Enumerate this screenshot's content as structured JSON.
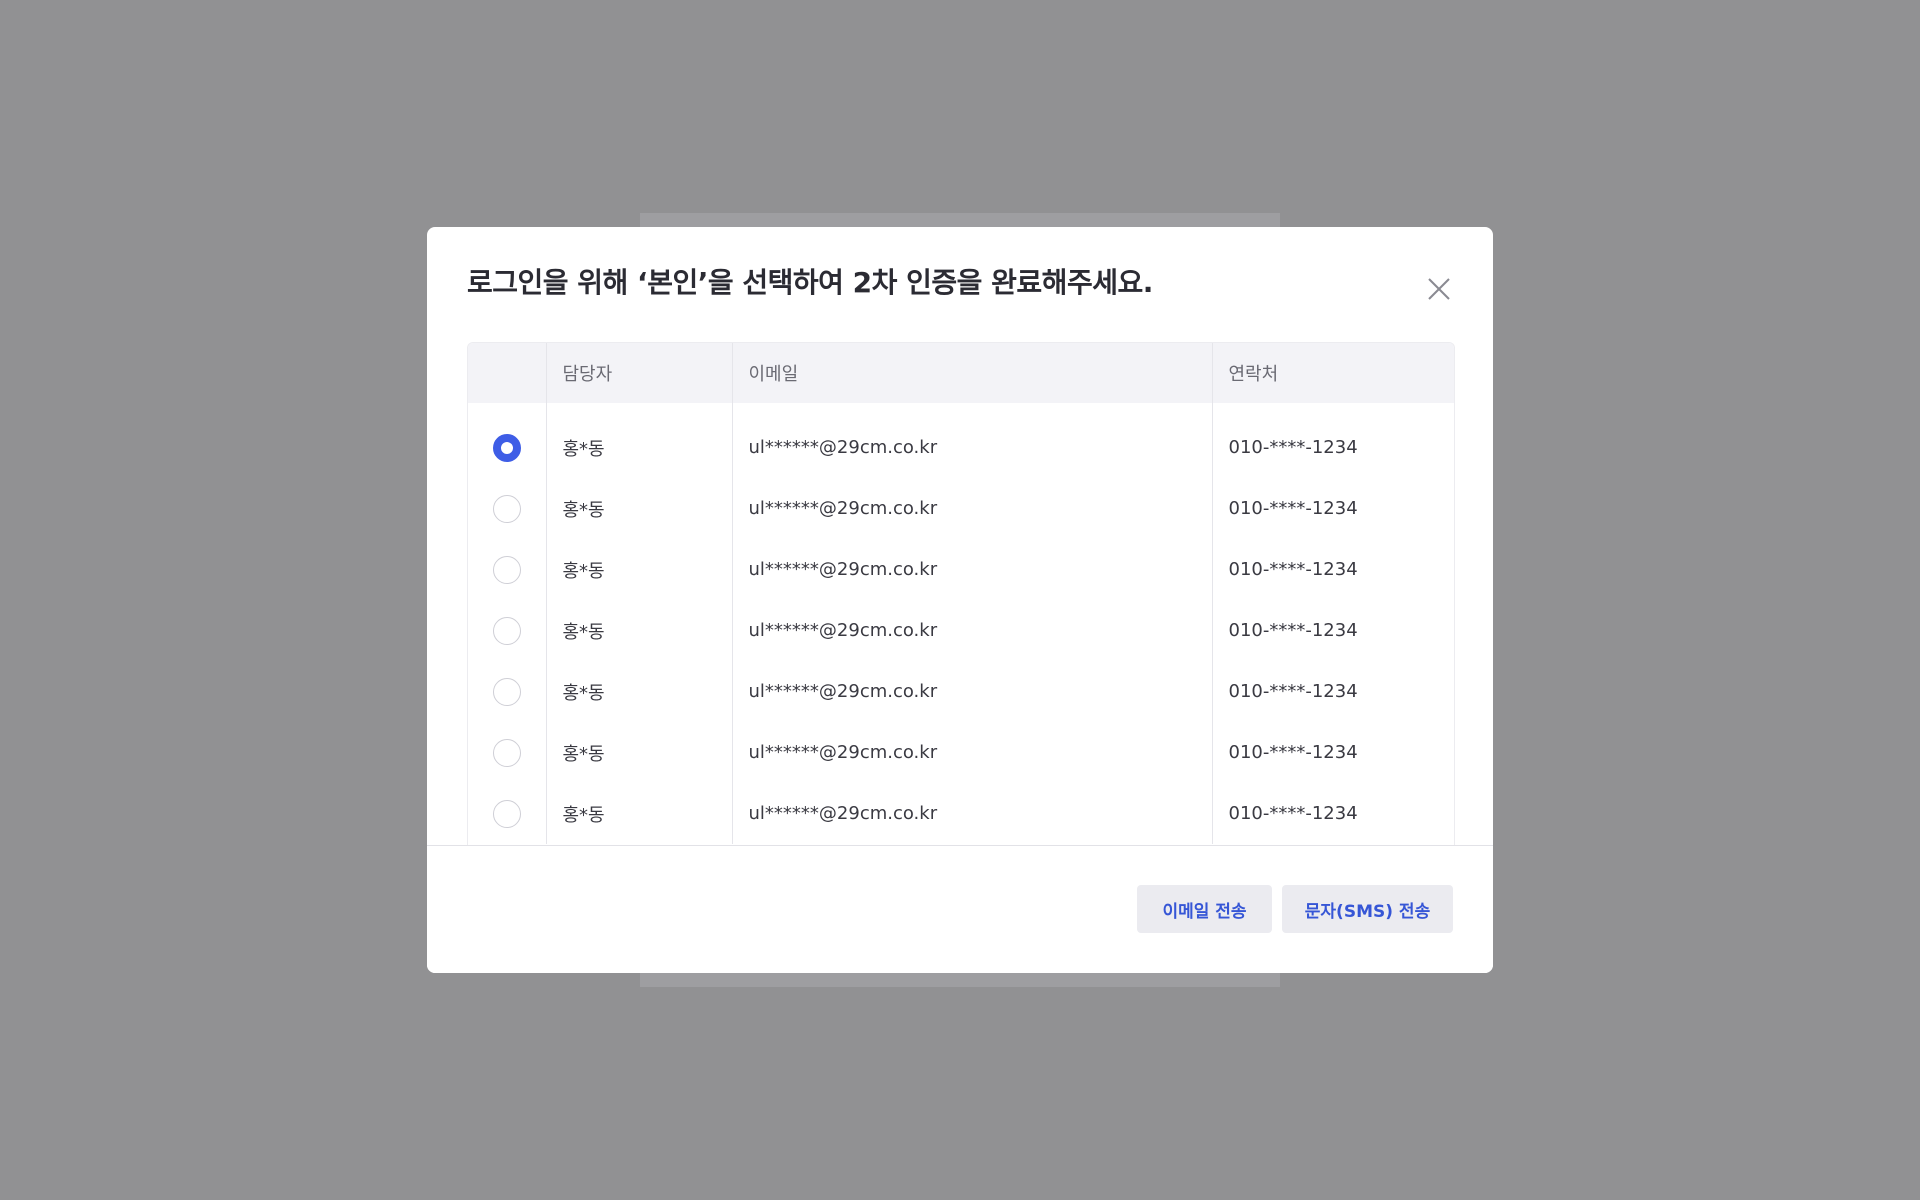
{
  "modal": {
    "title": "로그인을 위해 ‘본인’을 선택하여 2차 인증을 완료해주세요.",
    "close_icon": "close-icon"
  },
  "table": {
    "headers": {
      "manager": "담당자",
      "email": "이메일",
      "phone": "연락처"
    },
    "rows": [
      {
        "selected": true,
        "name": "홍*동",
        "email": "ul******@29cm.co.kr",
        "phone": "010-****-1234"
      },
      {
        "selected": false,
        "name": "홍*동",
        "email": "ul******@29cm.co.kr",
        "phone": "010-****-1234"
      },
      {
        "selected": false,
        "name": "홍*동",
        "email": "ul******@29cm.co.kr",
        "phone": "010-****-1234"
      },
      {
        "selected": false,
        "name": "홍*동",
        "email": "ul******@29cm.co.kr",
        "phone": "010-****-1234"
      },
      {
        "selected": false,
        "name": "홍*동",
        "email": "ul******@29cm.co.kr",
        "phone": "010-****-1234"
      },
      {
        "selected": false,
        "name": "홍*동",
        "email": "ul******@29cm.co.kr",
        "phone": "010-****-1234"
      },
      {
        "selected": false,
        "name": "홍*동",
        "email": "ul******@29cm.co.kr",
        "phone": "010-****-1234"
      }
    ]
  },
  "footer": {
    "email_button": "이메일 전송",
    "sms_button": "문자(SMS) 전송"
  },
  "colors": {
    "accent": "#3e5de6",
    "button_text": "#3656d6",
    "backdrop": "#919193"
  }
}
